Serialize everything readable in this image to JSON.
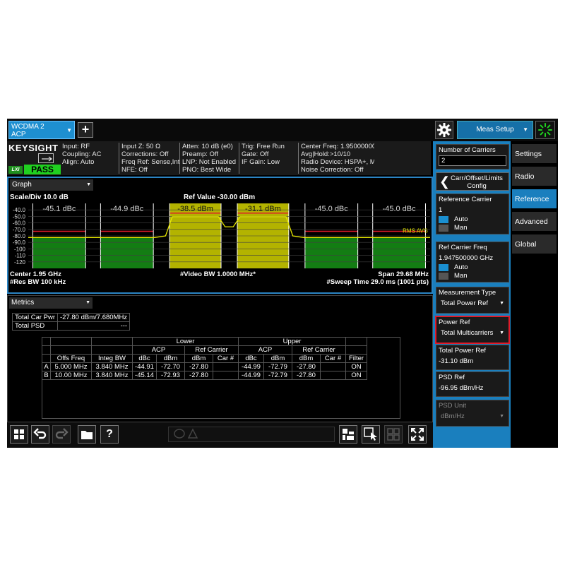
{
  "top_bar": {
    "screen_tab_line1": "WCDMA 2",
    "screen_tab_line2": "ACP",
    "add_tab_label": "+",
    "meas_setup_label": "Meas Setup"
  },
  "info_bar": {
    "brand": "KEYSIGHT",
    "status": "PASS",
    "lxi": "LXI",
    "col1": [
      "Input: RF",
      "Coupling: AC",
      "Align: Auto"
    ],
    "col2": [
      "Input Z: 50 Ω",
      "Corrections: Off",
      "Freq Ref: Sense,Int",
      "NFE: Off"
    ],
    "col3": [
      "Atten: 10 dB (e0)",
      "Preamp: Off",
      "LNP: Not Enabled",
      "PNO: Best Wide"
    ],
    "col4": [
      "Trig: Free Run",
      "Gate: Off",
      "IF Gain: Low"
    ],
    "col5": [
      "Center Freq: 1.95000000",
      "Avg|Hold:>10/10",
      "Radio Device: HSPA+, M",
      "Noise Correction: Off"
    ]
  },
  "graph": {
    "window_title": "Graph",
    "scale_div": "Scale/Div 10.0 dB",
    "ref_value": "Ref Value -30.00 dBm",
    "center": "Center 1.95 GHz",
    "res_bw": "#Res BW 100 kHz",
    "video_bw": "#Video BW 1.0000 MHz*",
    "span": "Span 29.68 MHz",
    "sweep_time": "#Sweep Time 29.0 ms (1001 pts)",
    "trace_label": "RMS AVG",
    "y_ticks": [
      "-40.0",
      "-50.0",
      "-60.0",
      "-70.0",
      "-80.0",
      "-90.0",
      "-100",
      "-110",
      "-120"
    ],
    "band_labels": [
      "-45.1 dBc",
      "-44.9 dBc",
      "-38.5 dBm",
      "-31.1 dBm",
      "-45.0 dBc",
      "-45.0 dBc"
    ]
  },
  "metrics": {
    "window_title": "Metrics",
    "total_car_pwr_label": "Total Car Pwr",
    "total_car_pwr_value": "-27.80 dBm/7.680MHz",
    "total_psd_label": "Total PSD",
    "total_psd_value": "---",
    "headers": {
      "lower": "Lower",
      "upper": "Upper",
      "acp": "ACP",
      "ref_carrier": "Ref Carrier",
      "offs_freq": "Offs Freq",
      "integ_bw": "Integ BW",
      "dbc": "dBc",
      "dbm": "dBm",
      "car_num": "Car #",
      "filter": "Filter"
    },
    "rows": [
      [
        "A",
        "5.000 MHz",
        "3.840 MHz",
        "-44.91",
        "-72.70",
        "-27.80",
        "",
        "-44.99",
        "-72.79",
        "-27.80",
        "",
        "ON"
      ],
      [
        "B",
        "10.00 MHz",
        "3.840 MHz",
        "-45.14",
        "-72.93",
        "-27.80",
        "",
        "-44.99",
        "-72.79",
        "-27.80",
        "",
        "ON"
      ]
    ]
  },
  "side_panel": {
    "num_carriers_label": "Number of Carriers",
    "num_carriers_value": "2",
    "carr_config_line1": "Carr/Offset/Limits",
    "carr_config_line2": "Config",
    "ref_carrier_label": "Reference Carrier",
    "ref_carrier_value": "1",
    "auto_label": "Auto",
    "man_label": "Man",
    "ref_carrier_freq_label": "Ref Carrier Freq",
    "ref_carrier_freq_value": "1.947500000 GHz",
    "meas_type_label": "Measurement Type",
    "meas_type_value": "Total Power Ref",
    "power_ref_label": "Power Ref",
    "power_ref_value": "Total Multicarriers",
    "total_power_ref_label": "Total Power Ref",
    "total_power_ref_value": "-31.10 dBm",
    "psd_ref_label": "PSD Ref",
    "psd_ref_value": "-96.95 dBm/Hz",
    "psd_unit_label": "PSD Unit",
    "psd_unit_value": "dBm/Hz"
  },
  "right_tabs": [
    "Settings",
    "Radio",
    "Reference",
    "Advanced",
    "Global"
  ],
  "toolbar": {
    "help_label": "?"
  },
  "chart_data": {
    "type": "line",
    "xlabel": "",
    "ylabel": "",
    "ylim": [
      -130,
      -30
    ],
    "y_tick_values": [
      -40,
      -50,
      -60,
      -70,
      -80,
      -90,
      -100,
      -110,
      -120
    ],
    "x_range_mhz": [
      1935.16,
      1964.84
    ],
    "series": [
      {
        "x_mhz": [
          1935.16,
          1937.5,
          1940.0,
          1942.5,
          1944.5,
          1945.3,
          1945.8,
          1947.5,
          1949.2,
          1949.7,
          1950.3,
          1950.8,
          1952.5,
          1954.2,
          1954.7,
          1955.5,
          1957.5,
          1960.0,
          1962.5,
          1964.84
        ],
        "y_dbm": [
          -82.5,
          -82.5,
          -82.5,
          -82.5,
          -82.5,
          -80,
          -50.5,
          -50.5,
          -50.5,
          -66,
          -66,
          -50.5,
          -50.5,
          -50.5,
          -80,
          -82.5,
          -82.5,
          -82.5,
          -82.5,
          -82.5
        ]
      }
    ],
    "bands": [
      {
        "label": "-45.1 dBc",
        "from_mhz": 1935.5,
        "to_mhz": 1939.4,
        "limit_dbm": -73,
        "kind": "offset"
      },
      {
        "label": "-44.9 dBc",
        "from_mhz": 1940.5,
        "to_mhz": 1944.4,
        "limit_dbm": -73,
        "kind": "offset"
      },
      {
        "label": "-38.5 dBm",
        "from_mhz": 1945.6,
        "to_mhz": 1949.4,
        "limit_dbm": -45,
        "kind": "carrier"
      },
      {
        "label": "-31.1 dBm",
        "from_mhz": 1950.6,
        "to_mhz": 1954.4,
        "limit_dbm": -45,
        "kind": "carrier"
      },
      {
        "label": "-45.0 dBc",
        "from_mhz": 1955.6,
        "to_mhz": 1959.5,
        "limit_dbm": -73,
        "kind": "offset"
      },
      {
        "label": "-45.0 dBc",
        "from_mhz": 1960.6,
        "to_mhz": 1964.5,
        "limit_dbm": -73,
        "kind": "offset"
      }
    ],
    "colors": {
      "trace": "#e6e600",
      "carrier_band": "#b3b300",
      "offset_band": "#137d13",
      "limit_line": "#e01b2a",
      "grid": "#404040"
    }
  }
}
